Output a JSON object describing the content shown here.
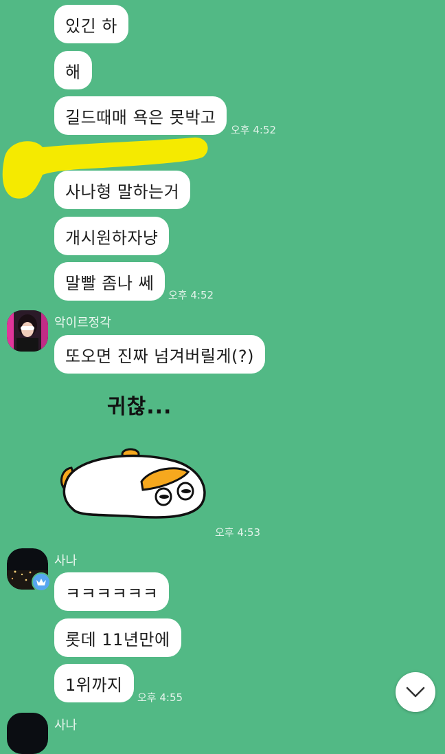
{
  "messages": {
    "m1": "있긴 하",
    "m2": "해",
    "m3": "길드때매 욕은 못박고",
    "m4": "사나형 말하는거",
    "m5": "개시원하자냥",
    "m6": "말빨 좀나 쎄",
    "m7": "또오면 진짜 넘겨버릴게(?)",
    "m8": "ㅋㅋㅋㅋㅋㅋ",
    "m9": "롯데 11년만에",
    "m10": "1위까지"
  },
  "times": {
    "t1": "오후 4:52",
    "t2": "오후 4:52",
    "t3": "오후 4:53",
    "t4": "오후 4:55"
  },
  "senders": {
    "s1": "악이르정각",
    "s2": "사나",
    "s3": "사나"
  },
  "sticker": {
    "text": "귀찮..."
  },
  "icons": {
    "scroll_down": "chevron-down-icon",
    "crown_badge": "crown-icon"
  },
  "colors": {
    "background": "#52b985",
    "bubble": "#ffffff",
    "highlight": "#f5ea00"
  }
}
